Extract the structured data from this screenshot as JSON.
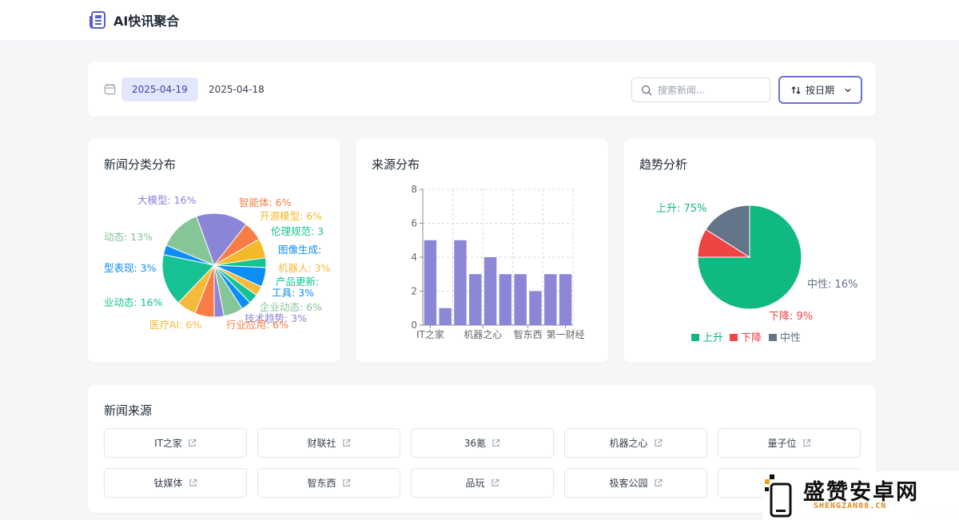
{
  "app": {
    "title": "AI快讯聚合",
    "icon": "newspaper-icon"
  },
  "filters": {
    "calendar_icon": "calendar-icon",
    "dates": [
      "2025-04-19",
      "2025-04-18"
    ],
    "active_date": "2025-04-19",
    "search_placeholder": "搜索新闻...",
    "sort_label": "按日期",
    "sort_icon": "sort-arrows-icon",
    "dropdown_icon": "chevron-down-icon"
  },
  "colors": {
    "accent": "#6b72d8",
    "bar": "#8c86d6",
    "up": "#10b981",
    "down": "#ef4444",
    "neutral": "#64748b"
  },
  "charts": {
    "category_title": "新闻分类分布",
    "source_title": "来源分布",
    "trend_title": "趋势分析"
  },
  "chart_data": [
    {
      "type": "pie",
      "title": "新闻分类分布",
      "labels": [
        "大模型: 16%",
        "智能体: 6%",
        "开源模型: 6%",
        "伦理规范: 3",
        "图像生成:",
        "机器人: 3%",
        "产品更新: ",
        "工具: 3%",
        "企业动态: 6%",
        "技术趋势: 3%",
        "行业应用: 6%",
        "医疗AI: 6%",
        "业动态: 16%",
        "型表现: 3%",
        "动态: 13%"
      ],
      "slices": [
        {
          "value": 16,
          "color": "#8b85d8"
        },
        {
          "value": 6,
          "color": "#f97c45"
        },
        {
          "value": 6,
          "color": "#f5b829"
        },
        {
          "value": 3,
          "color": "#17c391"
        },
        {
          "value": 6,
          "color": "#0e8ef5"
        },
        {
          "value": 3,
          "color": "#f6ba3a"
        },
        {
          "value": 3,
          "color": "#16c294"
        },
        {
          "value": 3,
          "color": "#0e8ef5"
        },
        {
          "value": 6,
          "color": "#86c597"
        },
        {
          "value": 3,
          "color": "#8b85d8"
        },
        {
          "value": 6,
          "color": "#f97c45"
        },
        {
          "value": 6,
          "color": "#f6ba3a"
        },
        {
          "value": 16,
          "color": "#16c294"
        },
        {
          "value": 3,
          "color": "#0e8ef5"
        },
        {
          "value": 13,
          "color": "#86c597"
        }
      ]
    },
    {
      "type": "bar",
      "title": "来源分布",
      "tick_labels": [
        "IT之家",
        "机器之心",
        "智东西",
        "第一财经"
      ],
      "values": [
        5,
        1,
        5,
        3,
        4,
        3,
        3,
        2,
        3,
        3
      ],
      "ylim": [
        0,
        8
      ],
      "yticks": [
        "0",
        "2",
        "4",
        "6",
        "8"
      ],
      "grid": true
    },
    {
      "type": "pie",
      "title": "趋势分析",
      "labels": [
        "上升: 75%",
        "下降: 9%",
        "中性: 16%"
      ],
      "legend": [
        "上升",
        "下降",
        "中性"
      ],
      "legend_position": "bottom",
      "values": [
        75,
        9,
        16
      ],
      "colors": [
        "#10b981",
        "#ef4444",
        "#64748b"
      ]
    }
  ],
  "sources": {
    "title": "新闻来源",
    "link_icon": "external-link-icon",
    "items": [
      "IT之家",
      "财联社",
      "36氪",
      "机器之心",
      "量子位",
      "钛媒体",
      "智东西",
      "品玩",
      "极客公园",
      ""
    ]
  },
  "watermark": {
    "text": "盛赞安卓网",
    "sub": "SHENGZAN08.CN"
  }
}
